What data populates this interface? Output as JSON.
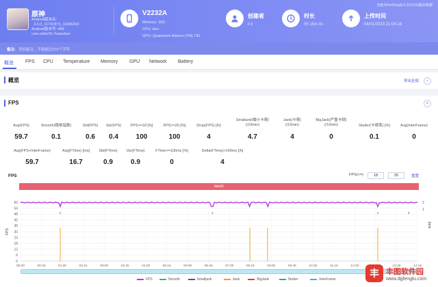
{
  "header": {
    "app_name": "原神",
    "app_meta": "Android版本名:\n  3.3.0_11741873_11806263\nAndroid版本号: 489\ncom.miHoYo.Yuanshen",
    "device_title": "V2232A",
    "device_memory": "Memory: 15G",
    "device_cpu": "CPU: taro",
    "device_gpu": "GPU: Qualcomm Adreno (TM) 730",
    "creator_label": "创建者",
    "creator_value": "li li",
    "duration_label": "时长",
    "duration_value": "0h 15m 0s",
    "upload_label": "上传时间",
    "upload_value": "04/01/2023 21:04:18",
    "version_note": "当前为PerfDog(8.0.221015)版本数据"
  },
  "note_bar": {
    "key": "备注:",
    "value": "添加备注，不能超过200个字符"
  },
  "tabs": [
    "概览",
    "FPS",
    "CPU",
    "Temperature",
    "Memory",
    "GPU",
    "Network",
    "Battery"
  ],
  "overview": {
    "title": "概览",
    "export_label": "导出全部"
  },
  "fps_section": {
    "title": "FPS",
    "collapse_icon": "chevron-up-icon",
    "metrics_row1": [
      {
        "label": "Avg(FPS)",
        "value": "59.7"
      },
      {
        "label": "Smooth(稳帧指数)",
        "value": "0.1"
      },
      {
        "label": "Std(FPS)",
        "value": "0.6"
      },
      {
        "label": "Var(FPS)",
        "value": "0.4"
      },
      {
        "label": "FPS>=18 [%]",
        "value": "100"
      },
      {
        "label": "FPS>=25 [%]",
        "value": "100"
      },
      {
        "label": "Drop(FPS) [/h]",
        "value": "4"
      },
      {
        "label": "Smallank(微小卡顿)\n(/10min)",
        "value": "4.7"
      },
      {
        "label": "Jank(卡顿)\n(/10min)",
        "value": "4"
      },
      {
        "label": "BigJank(严重卡顿)\n(/10min)",
        "value": "0"
      },
      {
        "label": "Stutter(卡顿率) [%]",
        "value": "0.1"
      },
      {
        "label": "Avg(InterFrame)",
        "value": "0"
      }
    ],
    "metrics_row2": [
      {
        "label": "Avg(FPS+InterFrame)",
        "value": "59.7"
      },
      {
        "label": "Avg(FTime) [ms]",
        "value": "16.7"
      },
      {
        "label": "Std(FTime)",
        "value": "0.9"
      },
      {
        "label": "Var(FTime)",
        "value": "0.9"
      },
      {
        "label": "FTime>=100ms [%]",
        "value": "0"
      },
      {
        "label": "Delta(FTime)>100ms [/h]",
        "value": "4"
      }
    ]
  },
  "chart_controls": {
    "chart_title": "FPS",
    "filter_label": "FPS(<=)",
    "min_value": "18",
    "max_value": "25",
    "reset_label": "重置"
  },
  "chart_data": {
    "type": "line",
    "title": "FPS",
    "label_bar": "label1",
    "ylabel": "FPS",
    "y2label": "Jank",
    "ylim": [
      0,
      60
    ],
    "yticks": [
      0,
      6,
      12,
      18,
      24,
      30,
      36,
      42,
      48,
      54,
      60
    ],
    "y2ticks": [
      "2",
      "1"
    ],
    "xticks": [
      "00:00",
      "00:45",
      "01:30",
      "02:15",
      "03:00",
      "03:45",
      "04:30",
      "05:15",
      "06:00",
      "06:45",
      "07:30",
      "08:15",
      "09:00",
      "09:45",
      "10:30",
      "11:15",
      "12:00",
      "12:45",
      "13:30",
      "14:15"
    ],
    "x_range_s": [
      0,
      900
    ],
    "fps_baseline": 59.7,
    "fps_dips_s": [
      90,
      435,
      520,
      560,
      810
    ],
    "jank_spikes_s": [
      90,
      520,
      560,
      810
    ],
    "jank_labels": [
      {
        "t_s": 90,
        "text": "1"
      },
      {
        "t_s": 435,
        "text": "1"
      },
      {
        "t_s": 810,
        "text": "1"
      },
      {
        "t_s": 880,
        "text": "3"
      }
    ],
    "legend": [
      {
        "name": "FPS",
        "color": "#b23bd8"
      },
      {
        "name": "Smooth",
        "color": "#4caf50"
      },
      {
        "name": "Smalljank",
        "color": "#3f51b5"
      },
      {
        "name": "Jank",
        "color": "#f39c12"
      },
      {
        "name": "BigJank",
        "color": "#e53935"
      },
      {
        "name": "Stutter",
        "color": "#00acc1"
      },
      {
        "name": "InterFrame",
        "color": "#29b6f6"
      }
    ]
  },
  "watermark": {
    "logo_char": "丰",
    "title": "丰图软件园",
    "url": "www.dgfengtu.com"
  }
}
